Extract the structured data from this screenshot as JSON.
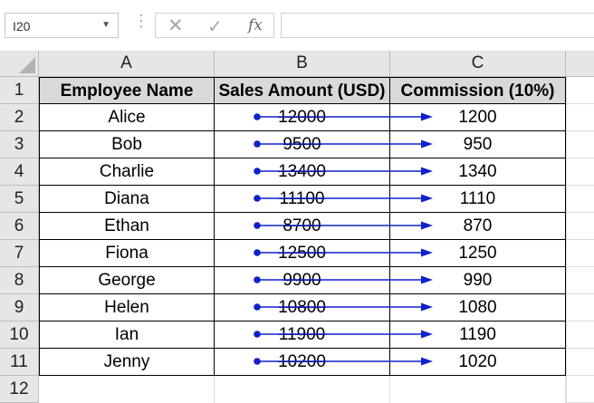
{
  "formula_bar": {
    "name_box": "I20",
    "cancel_glyph": "✕",
    "enter_glyph": "✓",
    "fx_label": "fx",
    "formula": ""
  },
  "columns": [
    "A",
    "B",
    "C"
  ],
  "rows": [
    "1",
    "2",
    "3",
    "4",
    "5",
    "6",
    "7",
    "8",
    "9",
    "10",
    "11",
    "12"
  ],
  "table": {
    "headers": [
      "Employee Name",
      "Sales Amount (USD)",
      "Commission (10%)"
    ],
    "data": [
      [
        "Alice",
        "12000",
        "1200"
      ],
      [
        "Bob",
        "9500",
        "950"
      ],
      [
        "Charlie",
        "13400",
        "1340"
      ],
      [
        "Diana",
        "11100",
        "1110"
      ],
      [
        "Ethan",
        "8700",
        "870"
      ],
      [
        "Fiona",
        "12500",
        "1250"
      ],
      [
        "George",
        "9900",
        "990"
      ],
      [
        "Helen",
        "10800",
        "1080"
      ],
      [
        "Ian",
        "11900",
        "1190"
      ],
      [
        "Jenny",
        "10200",
        "1020"
      ]
    ]
  },
  "colors": {
    "arrow": "#1020cc",
    "header_fill": "#d9d9d9",
    "grid_header": "#e6e6e6"
  }
}
